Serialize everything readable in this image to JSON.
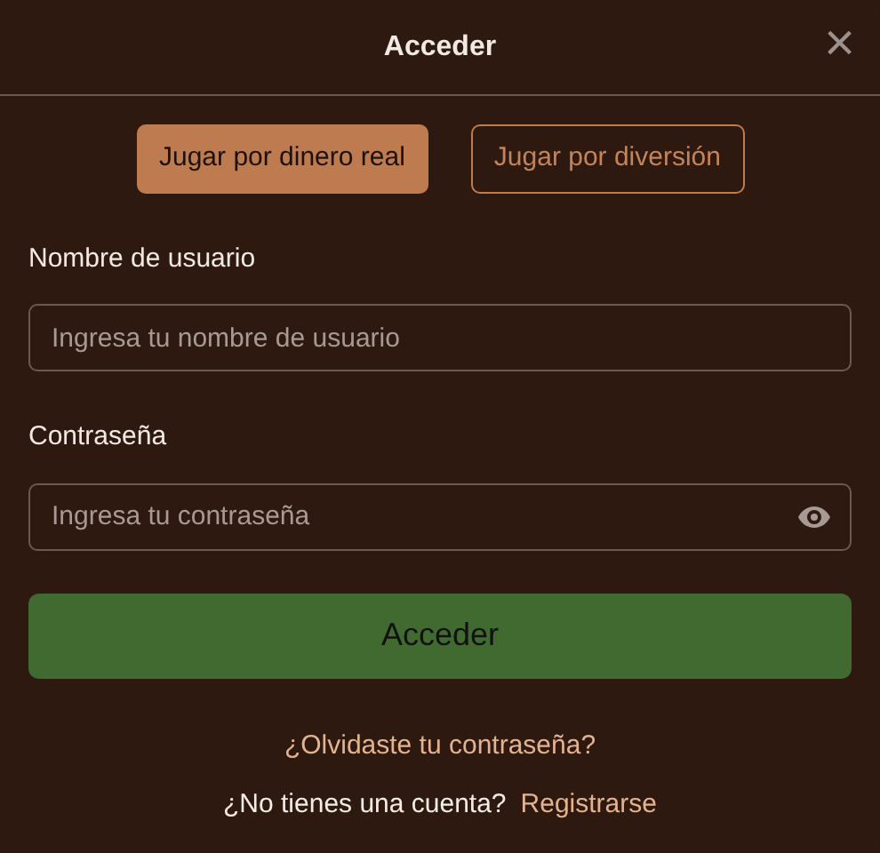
{
  "dialog": {
    "title": "Acceder",
    "close": "×"
  },
  "modes": [
    {
      "label": "Jugar por dinero real",
      "selected": true
    },
    {
      "label": "Jugar por diversión",
      "selected": false
    }
  ],
  "fields": [
    {
      "label": "Nombre de usuario",
      "placeholder": "Ingresa tu nombre de usuario",
      "kind": "text"
    },
    {
      "label": "Contraseña",
      "placeholder": "Ingresa tu contraseña",
      "kind": "password"
    }
  ],
  "submit": "Acceder",
  "forgot_link": "¿Olvidaste tu contraseña?",
  "signup": {
    "prompt": "¿No tienes una cuenta?",
    "link": "Registrarse"
  }
}
